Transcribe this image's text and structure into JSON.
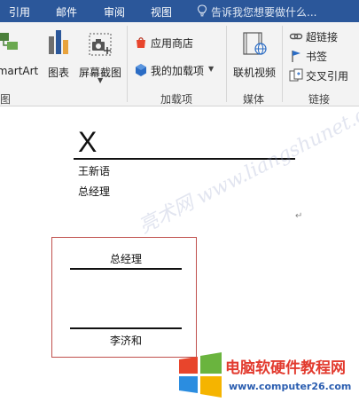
{
  "ribbon_tabs": [
    "引用",
    "邮件",
    "审阅",
    "视图"
  ],
  "tell_me": "告诉我您想要做什么...",
  "groups": {
    "illustrations": {
      "smartart_label": "martArt",
      "chart_label": "图表",
      "screenshot_label": "屏幕截图",
      "group_label": "图"
    },
    "addins": {
      "store_label": "应用商店",
      "my_addins_label": "我的加载项",
      "group_label": "加载项"
    },
    "media": {
      "online_video_label": "联机视频",
      "group_label": "媒体"
    },
    "links": {
      "hyperlink_label": "超链接",
      "bookmark_label": "书签",
      "crossref_label": "交叉引用",
      "group_label": "链接"
    }
  },
  "document": {
    "x_mark": "X",
    "signer_name": "王新语",
    "signer_title": "总经理",
    "textbox": {
      "title": "总经理",
      "name": "李济和"
    },
    "watermark": "亮术网 www.liangshunet.com"
  },
  "logo": {
    "title": "电脑软硬件教程网",
    "url": "www.computer26.com"
  }
}
